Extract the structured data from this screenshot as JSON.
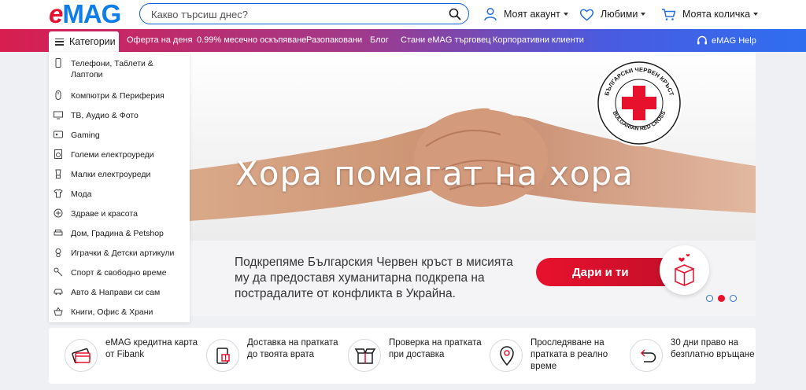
{
  "header": {
    "logo_e": "e",
    "logo_mag": "MAG",
    "search_placeholder": "Какво търсиш днес?",
    "account_label": "Моят акаунт",
    "favorites_label": "Любими",
    "cart_label": "Моята количка"
  },
  "navbar": {
    "categories_label": "Категории",
    "links": [
      "Оферта на деня",
      "0.99% месечно оскъпяване",
      "Разопаковани",
      "Блог",
      "Стани eMAG търговец",
      "Корпоративни клиенти"
    ],
    "help_label": "eMAG Help"
  },
  "categories": [
    "Телефони, Таблети & Лаптопи",
    "Компютри & Периферия",
    "ТВ, Аудио & Фото",
    "Gaming",
    "Големи електроуреди",
    "Малки електроуреди",
    "Мода",
    "Здраве и красота",
    "Дом, Градина & Petshop",
    "Играчки & Детски артикули",
    "Спорт & свободно време",
    "Авто & Направи си сам",
    "Книги, Офис & Храни"
  ],
  "banner": {
    "headline": "Хора помагат на хора",
    "subtext": "Подкрепяме Българския Червен кръст в мисията му да предоставя хуманитарна подкрепа на пострадалите от конфликта в Украйна.",
    "donate_label": "Дари и ти",
    "redcross_top": "БЪЛГАРСКИ ЧЕРВЕН КРЪСТ",
    "redcross_bottom": "BULGARIAN RED CROSS",
    "slide_count": 3,
    "active_slide": 2
  },
  "benefits": [
    "eMAG кредитна карта от Fibank",
    "Доставка на пратката до твоята врата",
    "Проверка на пратката при доставка",
    "Проследяване на пратката в реално време",
    "30 дни право на безплатно връщане"
  ],
  "colors": {
    "brand_red": "#e8112d",
    "brand_blue": "#0f7de8",
    "nav_start": "#d81e4f",
    "nav_end": "#2f6ef0"
  }
}
